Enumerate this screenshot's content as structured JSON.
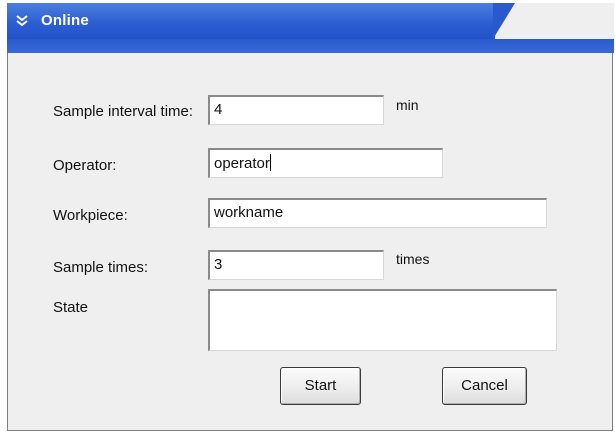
{
  "window": {
    "title": "Online",
    "title_icon": "collapse-arrows-icon"
  },
  "form": {
    "interval": {
      "label": "Sample interval time:",
      "value": "4",
      "unit": "min"
    },
    "operator": {
      "label": "Operator:",
      "value": "operator"
    },
    "workpiece": {
      "label": "Workpiece:",
      "value": "workname"
    },
    "sample_times": {
      "label": "Sample times:",
      "value": "3",
      "unit": "times"
    },
    "state": {
      "label": "State",
      "value": ""
    }
  },
  "buttons": {
    "start": "Start",
    "cancel": "Cancel"
  },
  "colors": {
    "title_bar": "#2e5ed2",
    "window_bg": "#efefef"
  }
}
